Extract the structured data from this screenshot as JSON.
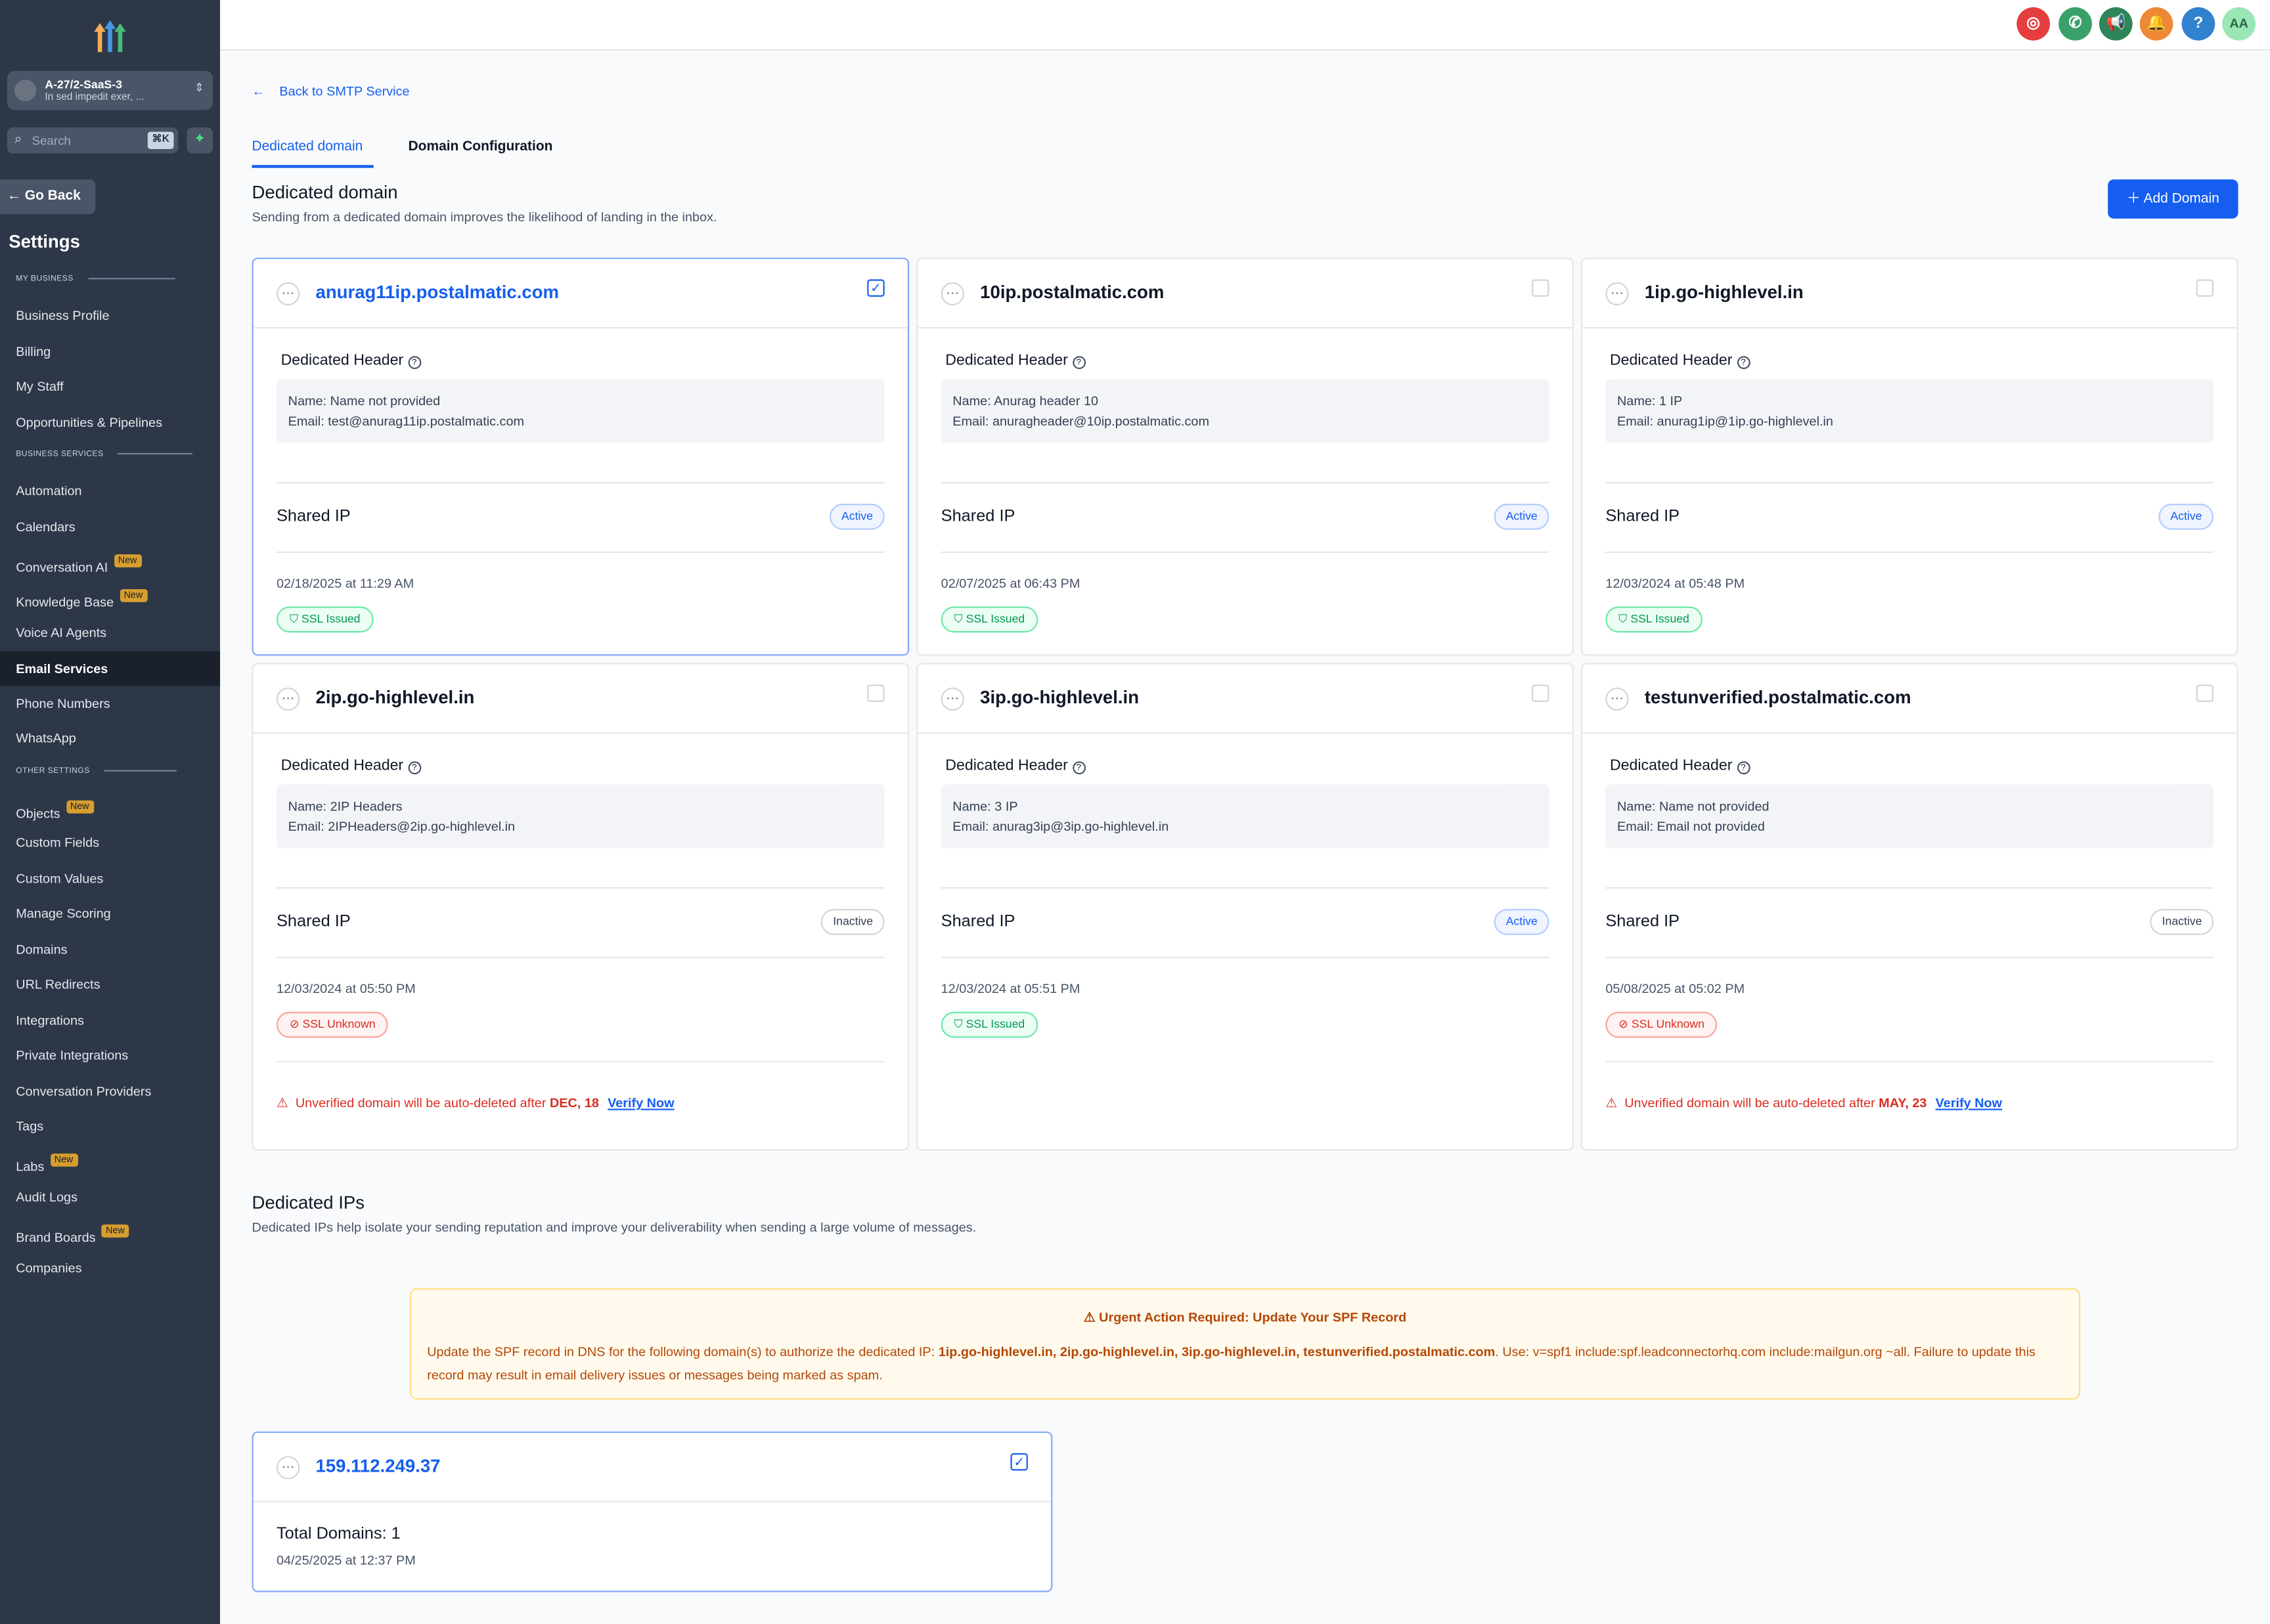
{
  "sidebar": {
    "account": {
      "name": "A-27/2-SaaS-3",
      "sub": "In sed impedit exer, ..."
    },
    "search": {
      "placeholder": "Search",
      "shortcut": "⌘K"
    },
    "go_back": "Go Back",
    "title": "Settings",
    "sections": {
      "my_business": "MY BUSINESS",
      "business_services": "BUSINESS SERVICES",
      "other_settings": "OTHER SETTINGS"
    },
    "items": [
      "Business Profile",
      "Billing",
      "My Staff",
      "Opportunities & Pipelines",
      "Automation",
      "Calendars",
      "Conversation AI",
      "Knowledge Base",
      "Voice AI Agents",
      "Email Services",
      "Phone Numbers",
      "WhatsApp",
      "Objects",
      "Custom Fields",
      "Custom Values",
      "Manage Scoring",
      "Domains",
      "URL Redirects",
      "Integrations",
      "Private Integrations",
      "Conversation Providers",
      "Tags",
      "Labs",
      "Audit Logs",
      "Brand Boards",
      "Companies"
    ],
    "new_badge": "New"
  },
  "topbar": {
    "avatar": "AA",
    "help": "?"
  },
  "main": {
    "back": "Back to SMTP Service",
    "tabs": [
      "Dedicated domain",
      "Domain Configuration"
    ],
    "dedicated_domain": {
      "title": "Dedicated domain",
      "subtitle": "Sending from a dedicated domain improves the likelihood of landing in the inbox.",
      "add_button": "Add Domain"
    },
    "card_labels": {
      "header": "Dedicated Header",
      "shared_ip": "Shared IP",
      "name": "Name:",
      "email": "Email:"
    },
    "domains": [
      {
        "domain": "anurag11ip.postalmatic.com",
        "name": "Name not provided",
        "email": "test@anurag11ip.postalmatic.com",
        "status": "Active",
        "date": "02/18/2025 at 11:29 AM",
        "ssl": "SSL Issued"
      },
      {
        "domain": "10ip.postalmatic.com",
        "name": "Anurag header 10",
        "email": "anuragheader@10ip.postalmatic.com",
        "status": "Active",
        "date": "02/07/2025 at 06:43 PM",
        "ssl": "SSL Issued"
      },
      {
        "domain": "1ip.go-highlevel.in",
        "name": "1 IP",
        "email": "anurag1ip@1ip.go-highlevel.in",
        "status": "Active",
        "date": "12/03/2024 at 05:48 PM",
        "ssl": "SSL Issued"
      },
      {
        "domain": "2ip.go-highlevel.in",
        "name": "2IP Headers",
        "email": "2IPHeaders@2ip.go-highlevel.in",
        "status": "Inactive",
        "date": "12/03/2024 at 05:50 PM",
        "ssl": "SSL Unknown",
        "warn_text": "Unverified domain will be auto-deleted after",
        "warn_date": "DEC, 18",
        "verify": "Verify Now"
      },
      {
        "domain": "3ip.go-highlevel.in",
        "name": "3 IP",
        "email": "anurag3ip@3ip.go-highlevel.in",
        "status": "Active",
        "date": "12/03/2024 at 05:51 PM",
        "ssl": "SSL Issued"
      },
      {
        "domain": "testunverified.postalmatic.com",
        "name": "Name not provided",
        "email": "Email not provided",
        "status": "Inactive",
        "date": "05/08/2025 at 05:02 PM",
        "ssl": "SSL Unknown",
        "warn_text": "Unverified domain will be auto-deleted after",
        "warn_date": "MAY, 23",
        "verify": "Verify Now"
      }
    ],
    "dedicated_ips": {
      "title": "Dedicated IPs",
      "subtitle": "Dedicated IPs help isolate your sending reputation and improve your deliverability when sending a large volume of messages."
    },
    "urgent": {
      "title": "Urgent Action Required: Update Your SPF Record",
      "body_prefix": "Update the SPF record in DNS for the following domain(s) to authorize the dedicated IP:",
      "domains": "1ip.go-highlevel.in, 2ip.go-highlevel.in, 3ip.go-highlevel.in, testunverified.postalmatic.com",
      "body_suffix": ". Use: v=spf1 include:spf.leadconnectorhq.com include:mailgun.org ~all. Failure to update this record may result in email delivery issues or messages being marked as spam."
    },
    "ip": {
      "address": "159.112.249.37",
      "total": "Total Domains: 1",
      "date": "04/25/2025 at 12:37 PM"
    }
  }
}
